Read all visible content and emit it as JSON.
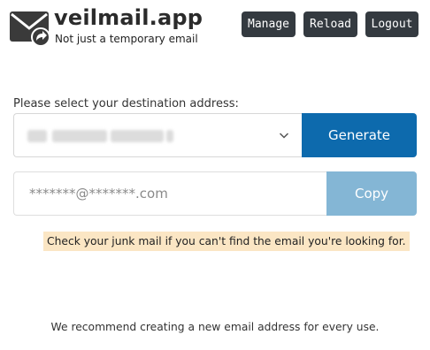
{
  "brand": {
    "title": "veilmail.app",
    "tagline": "Not just a temporary email"
  },
  "header": {
    "buttons": {
      "manage": "Manage",
      "reload": "Reload",
      "logout": "Logout"
    }
  },
  "destination": {
    "label": "Please select your destination address:",
    "selected_value": "",
    "generate_label": "Generate"
  },
  "result": {
    "email_placeholder": "*******@*******.com",
    "copy_label": "Copy"
  },
  "notice": {
    "text": "Check your junk mail if you can't find the email you're looking for."
  },
  "footer": {
    "text": "We recommend creating a new email address for every use."
  },
  "colors": {
    "dark_button": "#343a40",
    "primary": "#0d6aad",
    "primary_disabled": "#84b6d5",
    "notice_bg": "#fbe6c4"
  },
  "icons": {
    "logo": "envelope-share-icon",
    "dropdown": "chevron-down-icon"
  }
}
